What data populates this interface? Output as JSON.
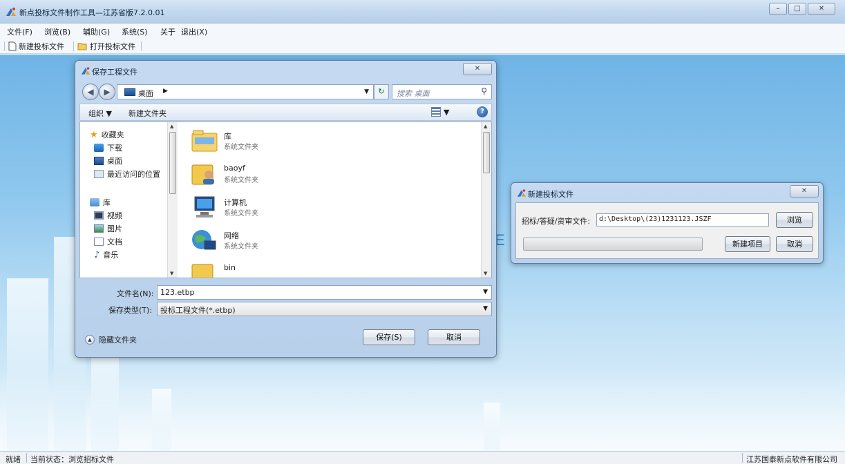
{
  "app": {
    "title": "新点投标文件制作工具—江苏省版7.2.0.01",
    "menu": [
      "文件(F)",
      "浏览(B)",
      "辅助(G)",
      "系统(S)",
      "关于",
      "退出(X)"
    ],
    "toolbar": {
      "new_label": "新建投标文件",
      "open_label": "打开投标文件"
    },
    "window_controls": {
      "minimize": "–",
      "maximize": "□",
      "close": "✕"
    },
    "background_letter": "E"
  },
  "status": {
    "ready": "就绪",
    "current_state": "当前状态：浏览招标文件",
    "company": "江苏国泰新点软件有限公司"
  },
  "save_dialog": {
    "title": "保存工程文件",
    "close_glyph": "✕",
    "address": "桌面",
    "search_placeholder": "搜索 桌面",
    "organize_label": "组织 ▼",
    "new_folder_label": "新建文件夹",
    "nav": {
      "favorites": "收藏夹",
      "favorites_items": [
        "下载",
        "桌面",
        "最近访问的位置"
      ],
      "libraries": "库",
      "library_items": [
        "视频",
        "图片",
        "文档",
        "音乐"
      ]
    },
    "files": [
      {
        "name": "库",
        "type": "系统文件夹",
        "icon": "library-folder-icon"
      },
      {
        "name": "baoyf",
        "type": "系统文件夹",
        "icon": "user-folder-icon"
      },
      {
        "name": "计算机",
        "type": "系统文件夹",
        "icon": "computer-icon"
      },
      {
        "name": "网络",
        "type": "系统文件夹",
        "icon": "network-icon"
      },
      {
        "name": "bin",
        "type": "",
        "icon": "folder-icon"
      }
    ],
    "filename_label": "文件名(N):",
    "filename_value": "123.etbp",
    "filetype_label": "保存类型(T):",
    "filetype_value": "投标工程文件(*.etbp)",
    "hide_folders_label": "隐藏文件夹",
    "save_button": "保存(S)",
    "cancel_button": "取消"
  },
  "new_dialog": {
    "title": "新建投标文件",
    "close_glyph": "✕",
    "path_label": "招标/答疑/资审文件:",
    "path_value": "d:\\Desktop\\(23)1231123.JSZF",
    "browse_button": "浏览",
    "new_project_button": "新建项目",
    "cancel_button": "取消",
    "progress": 0
  },
  "colors": {
    "accent": "#4f8fcd",
    "title_bar": "#c3d8ee",
    "workspace": "#8ec7ee"
  }
}
